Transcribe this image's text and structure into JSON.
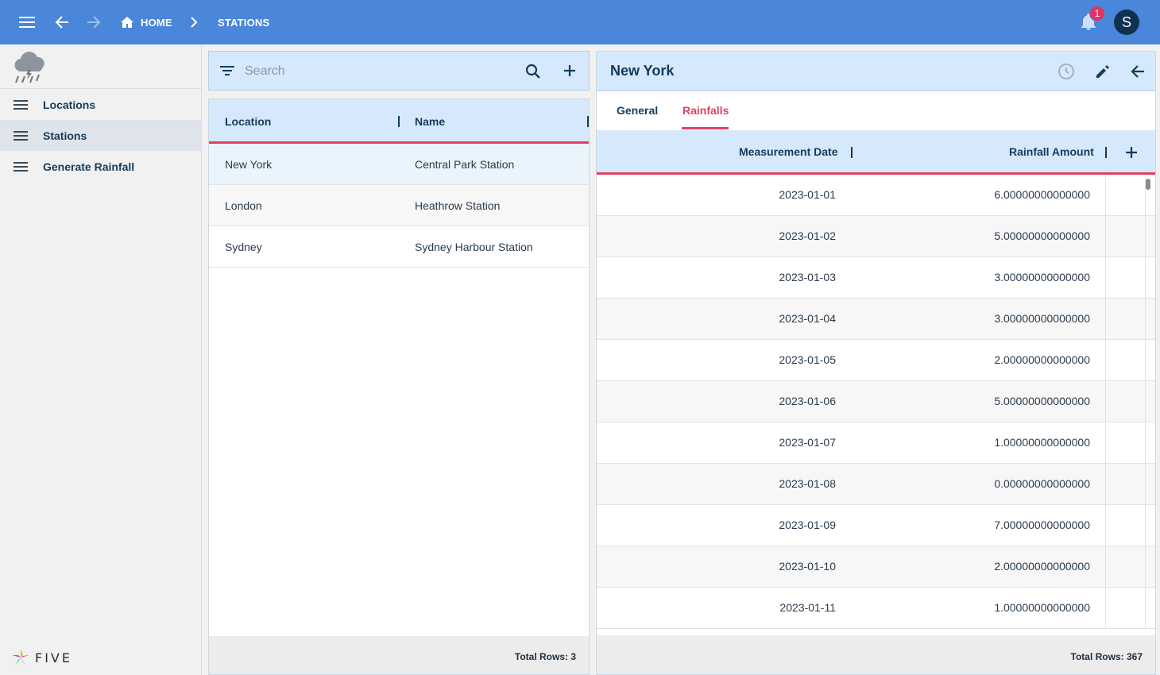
{
  "topbar": {
    "home_label": "HOME",
    "current_label": "STATIONS",
    "notification_count": "1",
    "avatar_initial": "S"
  },
  "sidebar": {
    "items": [
      {
        "label": "Locations"
      },
      {
        "label": "Stations"
      },
      {
        "label": "Generate Rainfall"
      }
    ],
    "active": "Stations",
    "logo_text": "FIVE"
  },
  "list": {
    "search_placeholder": "Search",
    "columns": [
      "Location",
      "Name"
    ],
    "rows": [
      {
        "location": "New York",
        "name": "Central Park Station"
      },
      {
        "location": "London",
        "name": "Heathrow Station"
      },
      {
        "location": "Sydney",
        "name": "Sydney Harbour Station"
      }
    ],
    "total_rows": "Total Rows: 3"
  },
  "detail": {
    "title": "New York",
    "tabs": [
      "General",
      "Rainfalls"
    ],
    "active_tab": "Rainfalls",
    "columns": [
      "Measurement Date",
      "Rainfall Amount"
    ],
    "rows": [
      {
        "date": "2023-01-01",
        "amount": "6.00000000000000"
      },
      {
        "date": "2023-01-02",
        "amount": "5.00000000000000"
      },
      {
        "date": "2023-01-03",
        "amount": "3.00000000000000"
      },
      {
        "date": "2023-01-04",
        "amount": "3.00000000000000"
      },
      {
        "date": "2023-01-05",
        "amount": "2.00000000000000"
      },
      {
        "date": "2023-01-06",
        "amount": "5.00000000000000"
      },
      {
        "date": "2023-01-07",
        "amount": "1.00000000000000"
      },
      {
        "date": "2023-01-08",
        "amount": "0.00000000000000"
      },
      {
        "date": "2023-01-09",
        "amount": "7.00000000000000"
      },
      {
        "date": "2023-01-10",
        "amount": "2.00000000000000"
      },
      {
        "date": "2023-01-11",
        "amount": "1.00000000000000"
      }
    ],
    "total_rows": "Total Rows: 367"
  },
  "colors": {
    "topbar": "#4a86d9",
    "accent": "#e0405f",
    "header_bg": "#d6e8fb",
    "badge": "#e53163",
    "avatar": "#0f3250"
  }
}
